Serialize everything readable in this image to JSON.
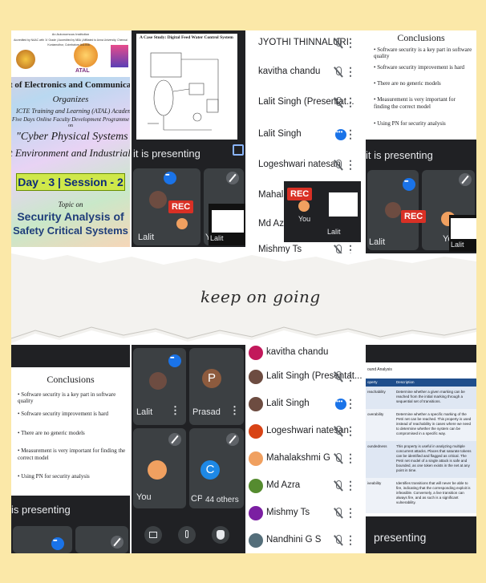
{
  "poster": {
    "institution_small": "An Autonomous Institution",
    "accreditation": "Accredited by NAAC with 'A' Grade | Accredited by NBA | Affiliated to Anna University, Chennai",
    "location": "Kuniamuthur, Coimbatore 641008.",
    "atal_logo": "ATAL",
    "department": "t of Electronics and Communication Engi",
    "organizes": "Organizes",
    "academy": "ICTE Training and Learning (ATAL) Academy",
    "program": "Five Days Online Faculty Development Programme",
    "on": "on",
    "topic_title_1": "\"Cyber Physical Systems for",
    "topic_title_2": "t Environment and Industrial",
    "session": "Day - 3  |  Session - 2",
    "topic_label": "Topic on",
    "talk_title_1": "Security Analysis of",
    "talk_title_2": "Safety Critical Systems"
  },
  "case_study": {
    "title": "A Case Study: Digital Feed Water Control System",
    "presenting": "it is presenting"
  },
  "grid_top": {
    "tiles": [
      {
        "name": "Lalit"
      },
      {
        "name": "You"
      }
    ],
    "rec": "REC",
    "self_view_name": "Lalit"
  },
  "participants_top": [
    {
      "name": "JYOTHI THINNALURI"
    },
    {
      "name": "kavitha chandu"
    },
    {
      "name": "Lalit Singh (Presentat..."
    },
    {
      "name": "Lalit Singh"
    },
    {
      "name": "Logeshwari natesan"
    },
    {
      "name": "Mahala"
    },
    {
      "name": "Md Azra"
    },
    {
      "name": "Mishmy Ts"
    }
  ],
  "popup_rec": "REC",
  "popup_you": "You",
  "popup_lalit": "Lalit",
  "right_top": {
    "title": "Conclusions",
    "bullets": [
      "Software security is a key part in software quality",
      "Software security improvement is hard",
      "There are no generic models",
      "Measurement is very important for finding the correct model",
      "Using PN for security analysis"
    ],
    "presenting": "it is presenting",
    "rec": "REC",
    "names": [
      "Lalit",
      "You",
      "Lalit"
    ]
  },
  "handwriting": "keep on going",
  "bottom_left": {
    "title": "Conclusions",
    "bullets": [
      "Software security is a key part in software quality",
      "Software security improvement is hard",
      "There are no generic models",
      "Measurement is very important for finding the correct model",
      "Using PN for security analysis"
    ],
    "presenting": "is presenting"
  },
  "grid_bottom": {
    "tiles": [
      {
        "name": "Lalit",
        "initial": ""
      },
      {
        "name": "Prasad",
        "initial": "P"
      },
      {
        "name": "You",
        "initial": ""
      },
      {
        "name": "CPS",
        "initial": "C"
      }
    ],
    "others": "44 others"
  },
  "participants_bottom": [
    {
      "name": "kavitha chandu"
    },
    {
      "name": "Lalit Singh (Presentat..."
    },
    {
      "name": "Lalit Singh"
    },
    {
      "name": "Logeshwari natesan"
    },
    {
      "name": "Mahalakshmi G"
    },
    {
      "name": "Md Azra"
    },
    {
      "name": "Mishmy Ts"
    },
    {
      "name": "Nandhini G S"
    }
  ],
  "table_slide": {
    "heading": "ound Analysis",
    "columns": [
      "operty",
      "Description"
    ],
    "rows": [
      {
        "prop": "reachability",
        "desc": "Determine whether a given marking can be reached from the initial marking through a sequential set of transitions."
      },
      {
        "prop": "overability",
        "desc": "Determine whether a specific marking of the Petri net can be reached. This property is used instead of reachability in cases where we need to determine whether the system can be compromised in a specific way."
      },
      {
        "prop": "oundedness",
        "desc": "This property is useful in analyzing multiple concurrent attacks. Places that saturate tokens can be identified and flagged as critical. The Petri net model of a single attack is safe and bounded, as one token exists in the net at any point in time."
      },
      {
        "prop": "iveability",
        "desc": "Identifies transitions that will never be able to fire, indicating that the corresponding exploit is infeasible. Conversely, a live transition can always fire, and as such is a significant vulnerability."
      }
    ],
    "presenting": "presenting"
  },
  "colors": {
    "frame": "#fbe8a8",
    "dark": "#202124",
    "tile": "#3c4043",
    "rec": "#d93025",
    "accent_blue": "#1a73e8",
    "session_green": "#cfe84a"
  }
}
